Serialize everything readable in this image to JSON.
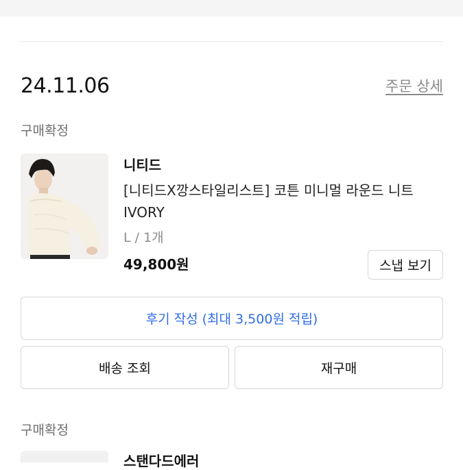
{
  "order": {
    "date": "24.11.06",
    "detail_link": "주문 상세"
  },
  "items": [
    {
      "status": "구매확정",
      "brand": "니티드",
      "name": "[니티드X깡스타일리스트] 코튼 미니멀 라운드 니트 IVORY",
      "option": "L / 1개",
      "price": "49,800원",
      "snap_button": "스냅 보기",
      "review_button": "후기 작성 (최대 3,500원 적립)",
      "delivery_button": "배송 조회",
      "rebuy_button": "재구매"
    },
    {
      "status": "구매확정",
      "brand": "스탠다드에러"
    }
  ],
  "colors": {
    "accent": "#2f6ce6",
    "muted_text": "#8a8a8a",
    "border": "#d6d6d6"
  }
}
